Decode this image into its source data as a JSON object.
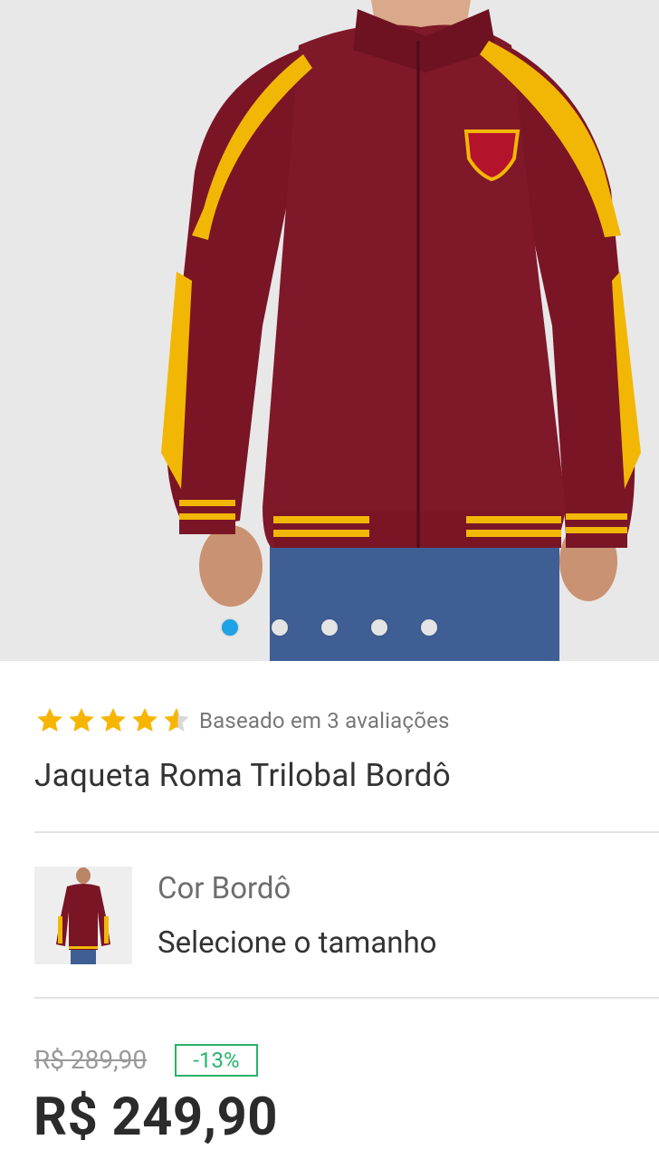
{
  "product": {
    "images_count": 5,
    "active_image_index": 0,
    "rating": {
      "value": 4.5,
      "max": 5,
      "text": "Baseado em 3 avaliações"
    },
    "title": "Jaqueta Roma Trilobal Bordô",
    "variant": {
      "color_label": "Cor Bordô",
      "size_prompt": "Selecione o tamanho"
    },
    "pricing": {
      "old_price": "R$ 289,90",
      "discount": "-13%",
      "price": "R$ 249,90"
    }
  },
  "colors": {
    "star": "#f7b500",
    "jacket": "#7a1526",
    "stripe": "#f2b705",
    "dot_active": "#1ea3e6",
    "discount": "#27b46a"
  },
  "icons": [
    "star-icon",
    "star-half-icon"
  ]
}
